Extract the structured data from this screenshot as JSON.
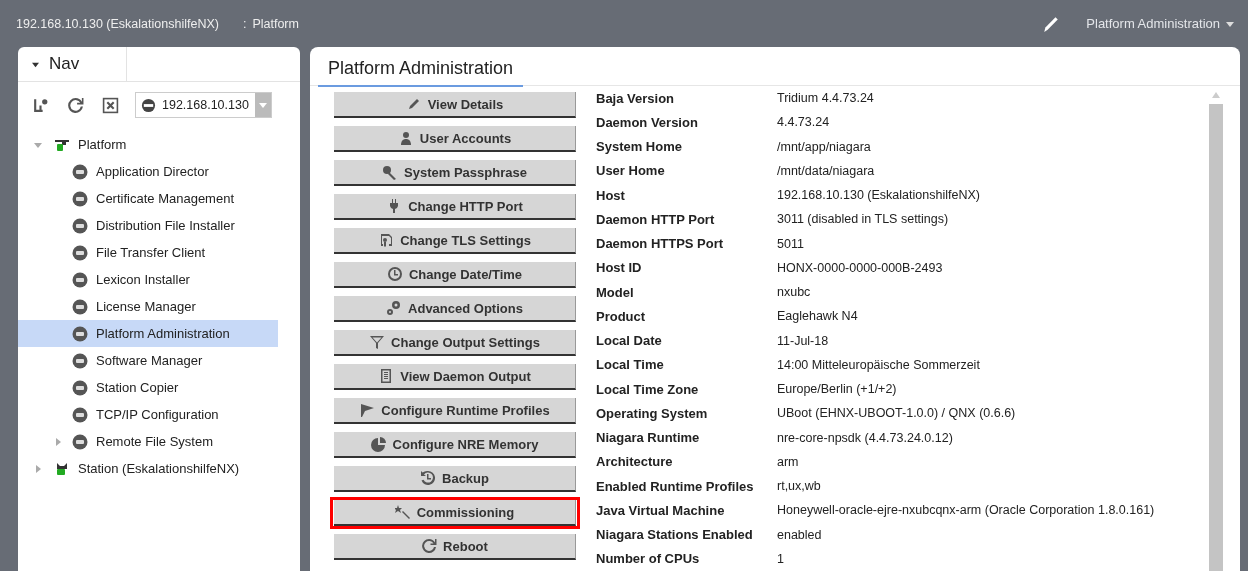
{
  "title_bar": {
    "host": "192.168.10.130 (EskalationshilfeNX)",
    "separator": ":",
    "location": "Platform",
    "view_menu": "Platform Administration"
  },
  "nav": {
    "tab": "Nav",
    "host_select": "192.168.10.130",
    "tree": [
      {
        "label": "Platform",
        "expanded": true,
        "selected": false,
        "children": [
          {
            "label": "Application Director",
            "selected": false
          },
          {
            "label": "Certificate Management",
            "selected": false
          },
          {
            "label": "Distribution File Installer",
            "selected": false
          },
          {
            "label": "File Transfer Client",
            "selected": false
          },
          {
            "label": "Lexicon Installer",
            "selected": false
          },
          {
            "label": "License Manager",
            "selected": false
          },
          {
            "label": "Platform Administration",
            "selected": true
          },
          {
            "label": "Software Manager",
            "selected": false
          },
          {
            "label": "Station Copier",
            "selected": false
          },
          {
            "label": "TCP/IP Configuration",
            "selected": false
          },
          {
            "label": "Remote File System",
            "selected": false,
            "expanded": false
          }
        ]
      },
      {
        "label": "Station (EskalationshilfeNX)",
        "expanded": false,
        "selected": false
      }
    ]
  },
  "main": {
    "tab": "Platform Administration",
    "buttons": [
      {
        "label": "View Details",
        "highlighted": false
      },
      {
        "label": "User Accounts",
        "highlighted": false
      },
      {
        "label": "System Passphrase",
        "highlighted": false
      },
      {
        "label": "Change HTTP Port",
        "highlighted": false
      },
      {
        "label": "Change TLS Settings",
        "highlighted": false
      },
      {
        "label": "Change Date/Time",
        "highlighted": false
      },
      {
        "label": "Advanced Options",
        "highlighted": false
      },
      {
        "label": "Change Output Settings",
        "highlighted": false
      },
      {
        "label": "View Daemon Output",
        "highlighted": false
      },
      {
        "label": "Configure Runtime Profiles",
        "highlighted": false
      },
      {
        "label": "Configure NRE Memory",
        "highlighted": false
      },
      {
        "label": "Backup",
        "highlighted": false
      },
      {
        "label": "Commissioning",
        "highlighted": true
      },
      {
        "label": "Reboot",
        "highlighted": false
      }
    ],
    "properties": [
      {
        "name": "Baja Version",
        "value": "Tridium 4.4.73.24"
      },
      {
        "name": "Daemon Version",
        "value": "4.4.73.24"
      },
      {
        "name": "System Home",
        "value": "/mnt/app/niagara"
      },
      {
        "name": "User Home",
        "value": "/mnt/data/niagara"
      },
      {
        "name": "Host",
        "value": "192.168.10.130 (EskalationshilfeNX)"
      },
      {
        "name": "Daemon HTTP Port",
        "value": "3011 (disabled in TLS settings)"
      },
      {
        "name": "Daemon HTTPS Port",
        "value": "5011"
      },
      {
        "name": "Host ID",
        "value": "HONX-0000-0000-000B-2493"
      },
      {
        "name": "Model",
        "value": "nxubc"
      },
      {
        "name": "Product",
        "value": "Eaglehawk N4"
      },
      {
        "name": "Local Date",
        "value": "11-Jul-18"
      },
      {
        "name": "Local Time",
        "value": "14:00 Mitteleuropäische Sommerzeit"
      },
      {
        "name": "Local Time Zone",
        "value": "Europe/Berlin (+1/+2)"
      },
      {
        "name": "Operating System",
        "value": "UBoot (EHNX-UBOOT-1.0.0) / QNX  (0.6.6)"
      },
      {
        "name": "Niagara Runtime",
        "value": "nre-core-npsdk (4.4.73.24.0.12)"
      },
      {
        "name": "Architecture",
        "value": "arm"
      },
      {
        "name": "Enabled Runtime Profiles",
        "value": "rt,ux,wb"
      },
      {
        "name": "Java Virtual Machine",
        "value": "Honeywell-oracle-ejre-nxubcqnx-arm (Oracle Corporation 1.8.0.161)"
      },
      {
        "name": "Niagara Stations Enabled",
        "value": "enabled"
      },
      {
        "name": "Number of CPUs",
        "value": "1"
      }
    ]
  }
}
